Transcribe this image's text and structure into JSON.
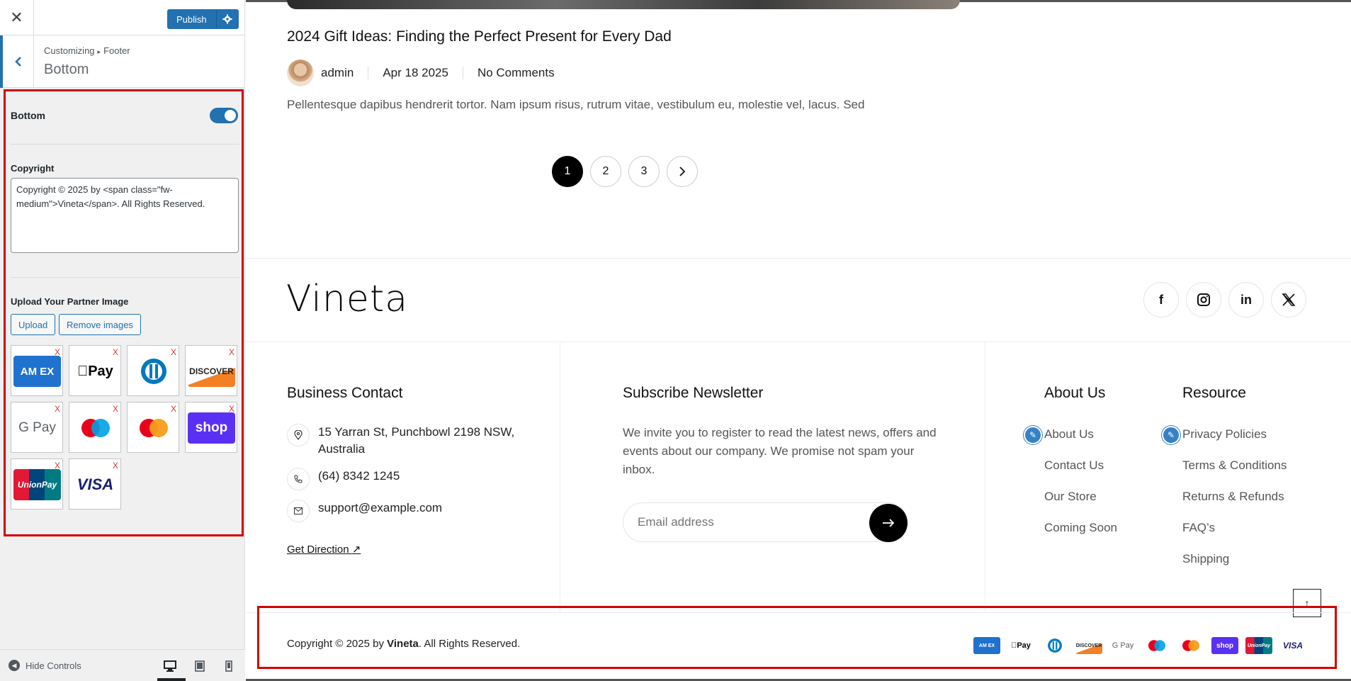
{
  "customizer": {
    "close_label": "✕",
    "publish_label": "Publish",
    "breadcrumb": [
      "Customizing",
      "Footer"
    ],
    "section_title": "Bottom",
    "bottom_toggle_label": "Bottom",
    "bottom_enabled": true,
    "copyright_label": "Copyright",
    "copyright_value": "Copyright © 2025 by <span class=\"fw-medium\">Vineta</span>. All Rights Reserved.",
    "partner_label": "Upload Your Partner Image",
    "upload_label": "Upload",
    "remove_label": "Remove images",
    "remove_mark": "X",
    "partners": [
      "AMEX",
      "Apple Pay",
      "Diners Club",
      "DISCOVER",
      "G Pay",
      "Maestro",
      "Mastercard",
      "shop",
      "UnionPay",
      "VISA"
    ],
    "hide_controls_label": "Hide Controls",
    "accent": "#2271b1"
  },
  "preview": {
    "post_title": "2024 Gift Ideas: Finding the Perfect Present for Every Dad",
    "author": "admin",
    "date": "Apr 18 2025",
    "comments": "No Comments",
    "excerpt": "Pellentesque dapibus hendrerit tortor. Nam ipsum risus, rutrum vitae, vestibulum eu, molestie vel, lacus. Sed",
    "pages": [
      "1",
      "2",
      "3"
    ],
    "next_icon": "chevron-right-icon",
    "footer": {
      "logo": "Vineta",
      "socials": [
        "facebook-icon",
        "instagram-icon",
        "linkedin-icon",
        "x-icon"
      ],
      "business_title": "Business Contact",
      "address": "15 Yarran St, Punchbowl 2198 NSW, Australia",
      "phone": "(64) 8342 1245",
      "email": "support@example.com",
      "get_direction": "Get Direction",
      "newsletter_title": "Subscribe Newsletter",
      "newsletter_text": "We invite you to register to read the latest news, offers and events about our company. We promise not spam your inbox.",
      "email_placeholder": "Email address",
      "about_title": "About Us",
      "about_links": [
        "About Us",
        "Contact Us",
        "Our Store",
        "Coming Soon"
      ],
      "resource_title": "Resource",
      "resource_links": [
        "Privacy Policies",
        "Terms & Conditions",
        "Returns & Refunds",
        "FAQ’s",
        "Shipping"
      ],
      "copyright_prefix": "Copyright © 2025 by ",
      "copyright_brand": "Vineta",
      "copyright_suffix": ". All Rights Reserved.",
      "payments": [
        "AMEX",
        "Apple Pay",
        "Diners",
        "DISCOVER",
        "G Pay",
        "Maestro",
        "Mastercard",
        "shop",
        "UnionPay",
        "VISA"
      ]
    }
  },
  "labels": {
    "amex": "AM EX",
    "applepay": "Pay",
    "discover": "DISCOVER",
    "gpay": "G Pay",
    "shop": "shop",
    "unionpay": "UnionPay",
    "visa": "VISA"
  }
}
